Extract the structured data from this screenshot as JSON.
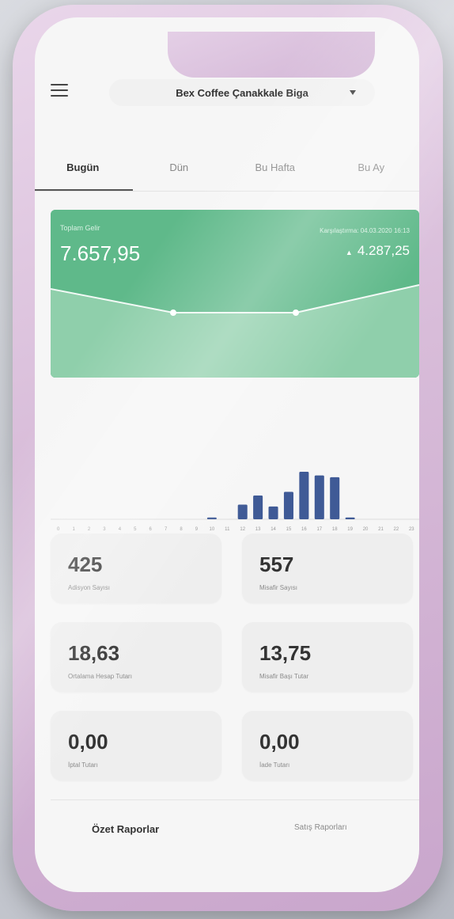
{
  "header": {
    "store_name": "Bex Coffee Çanakkale Biga"
  },
  "tabs": [
    {
      "label": "Bugün",
      "active": true
    },
    {
      "label": "Dün",
      "active": false
    },
    {
      "label": "Bu Hafta",
      "active": false
    },
    {
      "label": "Bu Ay",
      "active": false
    }
  ],
  "revenue": {
    "label": "Toplam Gelir",
    "value": "7.657,95",
    "comparison_label": "Karşılaştırma: 04.03.2020 16:13",
    "comparison_value": "4.287,25",
    "color": "#5fb98a"
  },
  "hourly_chart": {
    "type": "bar",
    "categories": [
      "0",
      "1",
      "2",
      "3",
      "4",
      "5",
      "6",
      "7",
      "8",
      "9",
      "10",
      "11",
      "12",
      "13",
      "14",
      "15",
      "16",
      "17",
      "18",
      "19",
      "20",
      "21",
      "22",
      "23"
    ],
    "values": [
      0,
      0,
      0,
      0,
      0,
      0,
      0,
      0,
      0,
      0,
      1,
      0,
      8,
      13,
      7,
      15,
      26,
      24,
      23,
      1,
      0,
      0,
      0,
      0
    ],
    "bar_color": "#3f5a96"
  },
  "stats": [
    {
      "value": "425",
      "label": "Adisyon Sayısı"
    },
    {
      "value": "557",
      "label": "Misafir Sayısı"
    },
    {
      "value": "18,63",
      "label": "Ortalama Hesap Tutarı"
    },
    {
      "value": "13,75",
      "label": "Misafir Başı Tutar"
    },
    {
      "value": "0,00",
      "label": "İptal Tutarı"
    },
    {
      "value": "0,00",
      "label": "İade Tutarı"
    }
  ],
  "bottom_tabs": [
    {
      "label": "Özet Raporlar"
    },
    {
      "label": "Satış Raporları"
    }
  ]
}
